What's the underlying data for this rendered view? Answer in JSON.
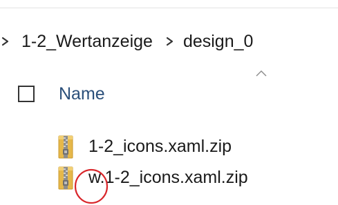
{
  "breadcrumb": {
    "items": [
      {
        "label": "1-2_Wertanzeige"
      },
      {
        "label": "design_0"
      }
    ]
  },
  "header": {
    "column_name": "Name",
    "sort_direction": "ascending"
  },
  "files": [
    {
      "name": "1-2_icons.xaml.zip",
      "icon": "zip-folder-icon"
    },
    {
      "name": "w.1-2_icons.xaml.zip",
      "icon": "zip-folder-icon"
    }
  ],
  "colors": {
    "column_header_text": "#2a4f7a",
    "annotation_circle": "#d9262b",
    "zip_folder_yellow": "#e6b84a",
    "zip_zipper": "#7a7a7a"
  }
}
